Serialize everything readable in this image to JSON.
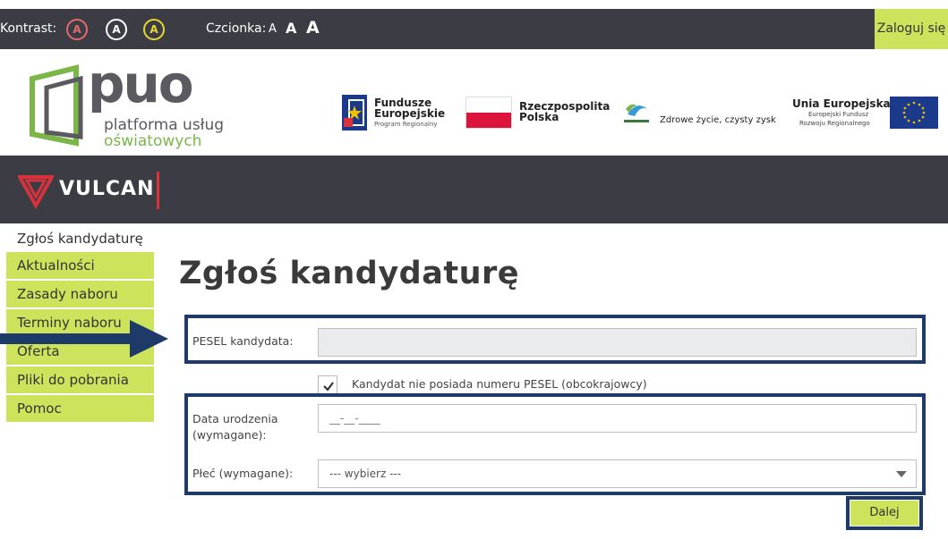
{
  "topbar": {
    "contrast_label": "Kontrast:",
    "contrast_options": [
      "A",
      "A",
      "A"
    ],
    "font_label": "Czcionka:",
    "font_sizes": [
      "A",
      "A",
      "A"
    ],
    "login_label": "Zaloguj się"
  },
  "header": {
    "puo_logo_text": "puo",
    "puo_line1": "platforma usług",
    "puo_line2": "oświatowych",
    "fe_title1": "Fundusze",
    "fe_title2": "Europejskie",
    "fe_subtitle": "Program Regionalny",
    "rp_line1": "Rzeczpospolita",
    "rp_line2": "Polska",
    "wm_slogan": "Zdrowe życie, czysty zysk",
    "ue_title": "Unia Europejska",
    "ue_line1": "Europejski Fundusz",
    "ue_line2": "Rozwoju Regionalnego"
  },
  "brand": {
    "name": "VULCAN"
  },
  "sidebar": {
    "active_item": "Zgłoś kandydaturę",
    "items": [
      {
        "label": "Aktualności"
      },
      {
        "label": "Zasady naboru"
      },
      {
        "label": "Terminy naboru"
      },
      {
        "label": "Oferta"
      },
      {
        "label": "Pliki do pobrania"
      },
      {
        "label": "Pomoc"
      }
    ]
  },
  "main": {
    "title": "Zgłoś kandydaturę",
    "pesel_label": "PESEL kandydata:",
    "pesel_value": "",
    "no_pesel_checkbox_label": "Kandydat nie posiada numeru PESEL (obcokrajowcy)",
    "no_pesel_checked": true,
    "birthdate_label_line1": "Data urodzenia",
    "birthdate_label_line2": "(wymagane):",
    "birthdate_placeholder": "__-__-____",
    "gender_label": "Płeć (wymagane):",
    "gender_selected": "--- wybierz ---",
    "next_button": "Dalej"
  },
  "colors": {
    "dark_bar": "#3c3c44",
    "accent_green": "#cde35b",
    "highlight_border": "#1e3a68",
    "vulcan_red": "#d8323d",
    "puo_green": "#7ab648"
  }
}
